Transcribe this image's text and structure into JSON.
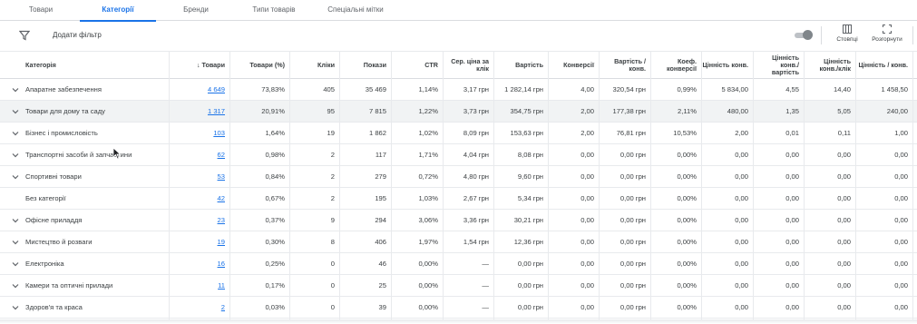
{
  "tabs": [
    "Товари",
    "Категорії",
    "Бренди",
    "Типи товарів",
    "Спеціальні мітки"
  ],
  "active_tab": "Категорії",
  "toolbar": {
    "add_filter": "Додати фільтр",
    "columns_label": "Стовпці",
    "expand_label": "Розгорнути"
  },
  "columns": [
    "Категорія",
    "↓ Товари",
    "Товари (%)",
    "Кліки",
    "Покази",
    "CTR",
    "Сер. ціна за клік",
    "Вартість",
    "Конверсії",
    "Вартість / конв.",
    "Коеф. конверсії",
    "Цінність конв.",
    "Цінність конв./ вартість",
    "Цінність конв./клік",
    "Цінність / конв."
  ],
  "rows": [
    {
      "name": "Апаратне забезпечення",
      "expand": true,
      "products": "4 649",
      "pct": "73,83%",
      "clicks": "405",
      "impr": "35 469",
      "ctr": "1,14%",
      "cpc": "3,17 грн",
      "cost": "1 282,14 грн",
      "conv": "4,00",
      "cost_conv": "320,54 грн",
      "conv_rate": "0,99%",
      "conv_value": "5 834,00",
      "value_cost": "4,55",
      "value_click": "14,40",
      "value_conv": "1 458,50"
    },
    {
      "name": "Товари для дому та саду",
      "expand": true,
      "highlight": true,
      "products": "1 317",
      "pct": "20,91%",
      "clicks": "95",
      "impr": "7 815",
      "ctr": "1,22%",
      "cpc": "3,73 грн",
      "cost": "354,75 грн",
      "conv": "2,00",
      "cost_conv": "177,38 грн",
      "conv_rate": "2,11%",
      "conv_value": "480,00",
      "value_cost": "1,35",
      "value_click": "5,05",
      "value_conv": "240,00"
    },
    {
      "name": "Бізнес і промисловість",
      "expand": true,
      "products": "103",
      "pct": "1,64%",
      "clicks": "19",
      "impr": "1 862",
      "ctr": "1,02%",
      "cpc": "8,09 грн",
      "cost": "153,63 грн",
      "conv": "2,00",
      "cost_conv": "76,81 грн",
      "conv_rate": "10,53%",
      "conv_value": "2,00",
      "value_cost": "0,01",
      "value_click": "0,11",
      "value_conv": "1,00"
    },
    {
      "name": "Транспортні засоби й запчастини",
      "expand": true,
      "products": "62",
      "pct": "0,98%",
      "clicks": "2",
      "impr": "117",
      "ctr": "1,71%",
      "cpc": "4,04 грн",
      "cost": "8,08 грн",
      "conv": "0,00",
      "cost_conv": "0,00 грн",
      "conv_rate": "0,00%",
      "conv_value": "0,00",
      "value_cost": "0,00",
      "value_click": "0,00",
      "value_conv": "0,00"
    },
    {
      "name": "Спортивні товари",
      "expand": true,
      "products": "53",
      "pct": "0,84%",
      "clicks": "2",
      "impr": "279",
      "ctr": "0,72%",
      "cpc": "4,80 грн",
      "cost": "9,60 грн",
      "conv": "0,00",
      "cost_conv": "0,00 грн",
      "conv_rate": "0,00%",
      "conv_value": "0,00",
      "value_cost": "0,00",
      "value_click": "0,00",
      "value_conv": "0,00"
    },
    {
      "name": "Без категорії",
      "expand": false,
      "products": "42",
      "pct": "0,67%",
      "clicks": "2",
      "impr": "195",
      "ctr": "1,03%",
      "cpc": "2,67 грн",
      "cost": "5,34 грн",
      "conv": "0,00",
      "cost_conv": "0,00 грн",
      "conv_rate": "0,00%",
      "conv_value": "0,00",
      "value_cost": "0,00",
      "value_click": "0,00",
      "value_conv": "0,00"
    },
    {
      "name": "Офісне приладдя",
      "expand": true,
      "products": "23",
      "pct": "0,37%",
      "clicks": "9",
      "impr": "294",
      "ctr": "3,06%",
      "cpc": "3,36 грн",
      "cost": "30,21 грн",
      "conv": "0,00",
      "cost_conv": "0,00 грн",
      "conv_rate": "0,00%",
      "conv_value": "0,00",
      "value_cost": "0,00",
      "value_click": "0,00",
      "value_conv": "0,00"
    },
    {
      "name": "Мистецтво й розваги",
      "expand": true,
      "products": "19",
      "pct": "0,30%",
      "clicks": "8",
      "impr": "406",
      "ctr": "1,97%",
      "cpc": "1,54 грн",
      "cost": "12,36 грн",
      "conv": "0,00",
      "cost_conv": "0,00 грн",
      "conv_rate": "0,00%",
      "conv_value": "0,00",
      "value_cost": "0,00",
      "value_click": "0,00",
      "value_conv": "0,00"
    },
    {
      "name": "Електроніка",
      "expand": true,
      "products": "16",
      "pct": "0,25%",
      "clicks": "0",
      "impr": "46",
      "ctr": "0,00%",
      "cpc": "—",
      "cost": "0,00 грн",
      "conv": "0,00",
      "cost_conv": "0,00 грн",
      "conv_rate": "0,00%",
      "conv_value": "0,00",
      "value_cost": "0,00",
      "value_click": "0,00",
      "value_conv": "0,00"
    },
    {
      "name": "Камери та оптичні прилади",
      "expand": true,
      "products": "11",
      "pct": "0,17%",
      "clicks": "0",
      "impr": "25",
      "ctr": "0,00%",
      "cpc": "—",
      "cost": "0,00 грн",
      "conv": "0,00",
      "cost_conv": "0,00 грн",
      "conv_rate": "0,00%",
      "conv_value": "0,00",
      "value_cost": "0,00",
      "value_click": "0,00",
      "value_conv": "0,00"
    },
    {
      "name": "Здоров'я та краса",
      "expand": true,
      "products": "2",
      "pct": "0,03%",
      "clicks": "0",
      "impr": "39",
      "ctr": "0,00%",
      "cpc": "—",
      "cost": "0,00 грн",
      "conv": "0,00",
      "cost_conv": "0,00 грн",
      "conv_rate": "0,00%",
      "conv_value": "0,00",
      "value_cost": "0,00",
      "value_click": "0,00",
      "value_conv": "0,00"
    }
  ],
  "colors": {
    "accent": "#1a73e8",
    "highlight_row": "#f1f3f4",
    "border": "#e8eaed"
  }
}
